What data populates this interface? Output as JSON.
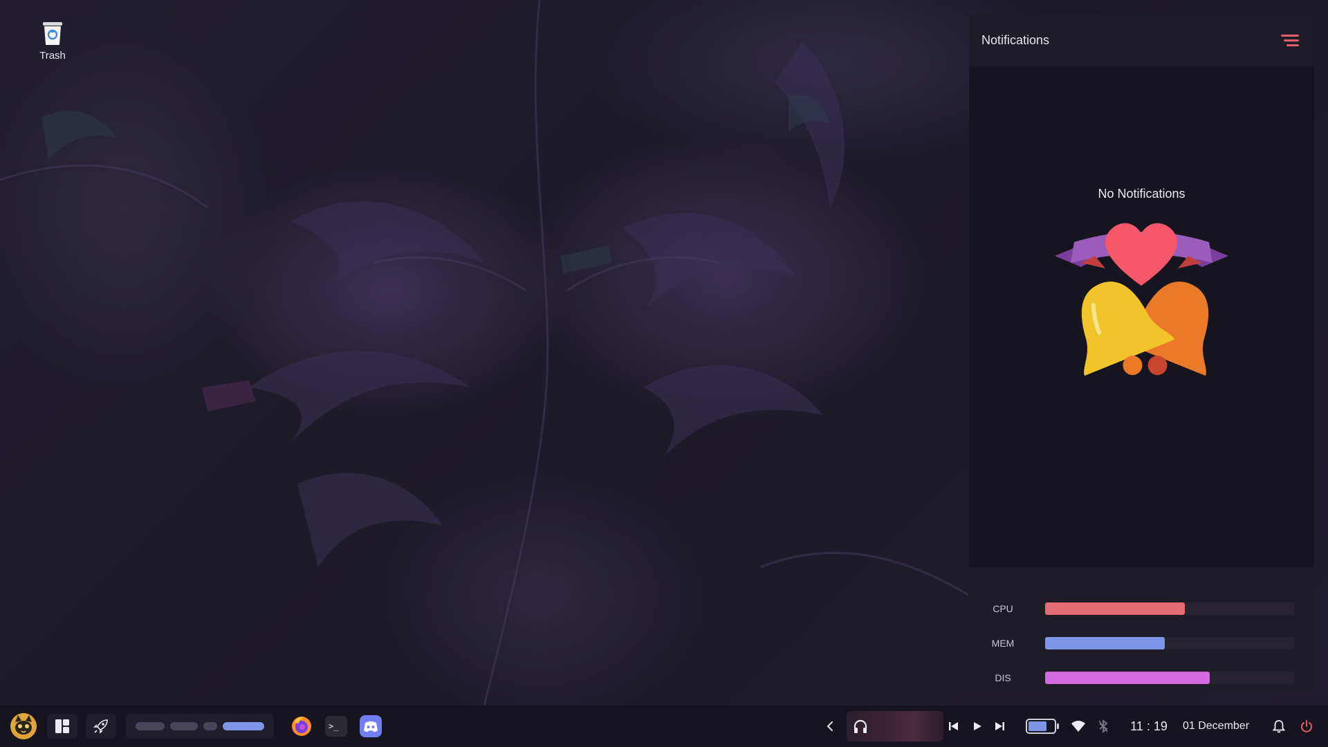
{
  "desktop": {
    "icons": [
      {
        "label": "Trash",
        "icon": "trash-icon"
      }
    ]
  },
  "notifications": {
    "title": "Notifications",
    "clear_icon": "clear-all-icon",
    "empty_text": "No Notifications",
    "illustration": "bells-heart-icon"
  },
  "stats": [
    {
      "label": "CPU",
      "percent": 56,
      "color": "#e06c75"
    },
    {
      "label": "MEM",
      "percent": 48,
      "color": "#7f95e8"
    },
    {
      "label": "DIS",
      "percent": 66,
      "color": "#d46be0"
    }
  ],
  "taskbar": {
    "avatar_icon": "cat-avatar-icon",
    "layout_icon": "layout-icon",
    "launcher_icon": "rocket-icon",
    "workspaces": [
      {
        "active": false
      },
      {
        "active": false
      },
      {
        "active": false
      },
      {
        "active": true
      }
    ],
    "apps": [
      {
        "name": "firefox",
        "icon": "firefox-icon",
        "color": "#ff8c2e"
      },
      {
        "name": "terminal",
        "icon": "terminal-icon",
        "color": "#2b2a33"
      },
      {
        "name": "discord",
        "icon": "discord-icon",
        "color": "#6f7ff0"
      }
    ],
    "tray": {
      "tray_toggle_icon": "chevron-left-icon",
      "media_icon": "headphones-icon",
      "prev_icon": "skip-previous-icon",
      "play_icon": "play-icon",
      "next_icon": "skip-next-icon",
      "battery_icon": "battery-icon",
      "wifi_icon": "wifi-icon",
      "bluetooth_icon": "bluetooth-icon",
      "bell_icon": "bell-icon",
      "power_icon": "power-icon"
    },
    "clock": "11 : 19",
    "date": "01 December"
  }
}
